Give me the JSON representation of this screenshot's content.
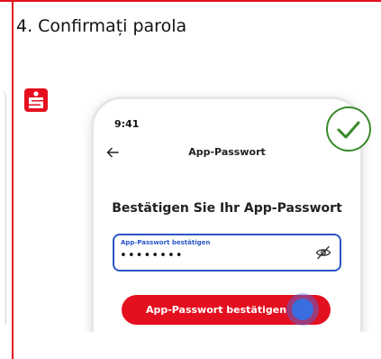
{
  "step": {
    "heading": "4. Confirmați parola"
  },
  "colors": {
    "brand_red": "#e4101f",
    "field_blue": "#2a56c6",
    "tap_blue": "#3a6ee0",
    "success_green": "#3a8a2c"
  },
  "logo": {
    "icon": "sparkasse-logo-icon"
  },
  "phone": {
    "status_time": "9:41",
    "nav": {
      "back_icon": "arrow-left-icon",
      "title": "App-Passwort"
    },
    "form": {
      "title": "Bestätigen Sie Ihr App-Passwort",
      "field_label": "App-Passwort bestätigen",
      "field_value": "••••••••",
      "visibility_icon": "eye-off-icon"
    },
    "button_label": "App-Passwort bestätigen"
  },
  "badge": {
    "icon": "checkmark-circle-icon"
  }
}
